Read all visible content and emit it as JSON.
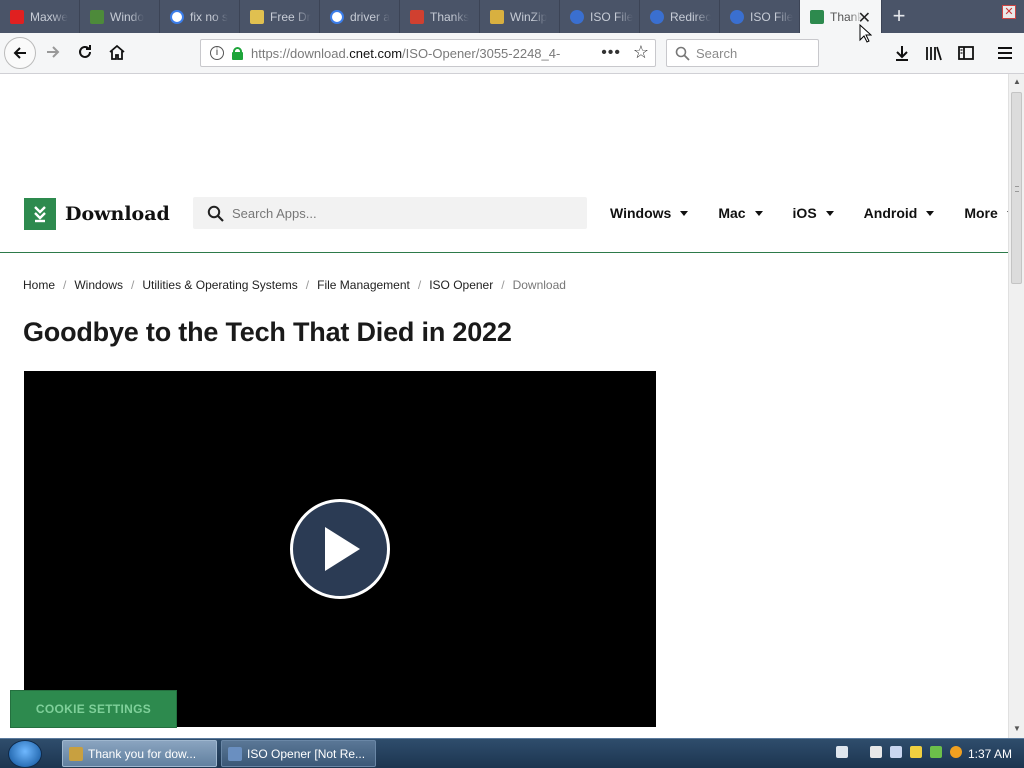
{
  "browser": {
    "tabs": [
      {
        "title": "Maxwe",
        "icon": "youtube-icon",
        "color": "#e02020"
      },
      {
        "title": "Windo",
        "icon": "windows-site-icon",
        "color": "#4d8a3a"
      },
      {
        "title": "fix no s",
        "icon": "google-icon",
        "color": "#ffffff"
      },
      {
        "title": "Free Dr",
        "icon": "driver-icon",
        "color": "#e0c050"
      },
      {
        "title": "driver a",
        "icon": "google-icon",
        "color": "#ffffff"
      },
      {
        "title": "Thanks",
        "icon": "flash-icon",
        "color": "#d04030"
      },
      {
        "title": "WinZip",
        "icon": "winzip-icon",
        "color": "#d8b040"
      },
      {
        "title": "ISO File",
        "icon": "globe-icon",
        "color": "#3a6fd0"
      },
      {
        "title": "Redirec",
        "icon": "globe-icon",
        "color": "#3a6fd0"
      },
      {
        "title": "ISO File",
        "icon": "globe-icon",
        "color": "#3a6fd0"
      },
      {
        "title": "Thank",
        "icon": "download-site-icon",
        "color": "#2d8a4e",
        "active": true
      }
    ],
    "new_tab_label": "+",
    "url_prefix": "https://download.",
    "url_domain": "cnet.com",
    "url_path": "/ISO-Opener/3055-2248_4-",
    "search_placeholder": "Search"
  },
  "site": {
    "logo_text": "Download",
    "search_placeholder": "Search Apps...",
    "nav": [
      {
        "label": "Windows"
      },
      {
        "label": "Mac"
      },
      {
        "label": "iOS"
      },
      {
        "label": "Android"
      },
      {
        "label": "More"
      }
    ],
    "breadcrumb": [
      {
        "label": "Home"
      },
      {
        "label": "Windows"
      },
      {
        "label": "Utilities & Operating Systems"
      },
      {
        "label": "File Management"
      },
      {
        "label": "ISO Opener"
      },
      {
        "label": "Download"
      }
    ],
    "headline": "Goodbye to the Tech That Died in 2022",
    "cookie_button": "COOKIE SETTINGS",
    "accent_color": "#2d8a4e"
  },
  "taskbar": {
    "tasks": [
      {
        "label": "Thank you for dow...",
        "active": true
      },
      {
        "label": "ISO Opener [Not Re...",
        "active": false
      }
    ],
    "clock": "1:37 AM"
  }
}
